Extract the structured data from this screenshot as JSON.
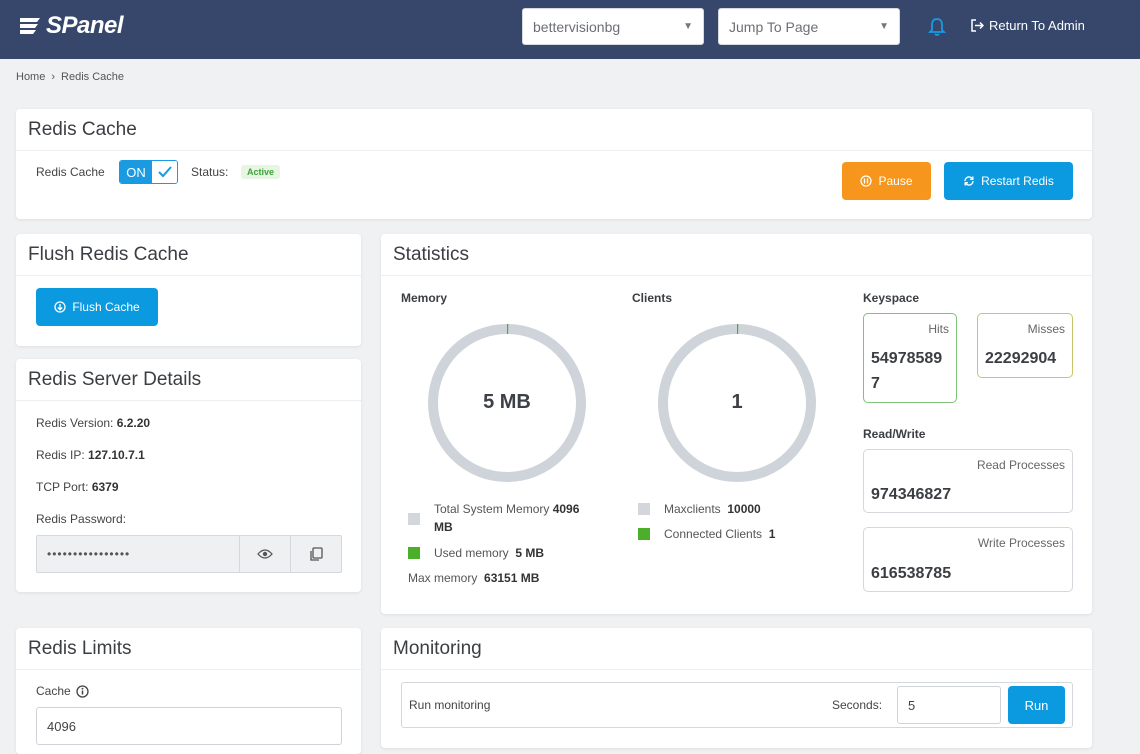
{
  "header": {
    "logo_text": "SPanel",
    "account_select": "bettervisionbg",
    "jump_select": "Jump To Page",
    "return_label": "Return To Admin"
  },
  "breadcrumb": {
    "home": "Home",
    "current": "Redis Cache"
  },
  "redis_cache": {
    "title": "Redis Cache",
    "toggle_label": "Redis Cache",
    "toggle_state": "ON",
    "status_label": "Status:",
    "status_value": "Active",
    "pause_label": "Pause",
    "restart_label": "Restart Redis"
  },
  "flush": {
    "title": "Flush Redis Cache",
    "button_label": "Flush Cache"
  },
  "server": {
    "title": "Redis Server Details",
    "version_label": "Redis Version:",
    "version_value": "6.2.20",
    "ip_label": "Redis IP:",
    "ip_value": "127.10.7.1",
    "port_label": "TCP Port:",
    "port_value": "6379",
    "password_label": "Redis Password:",
    "password_value": "••••••••••••••••"
  },
  "statistics": {
    "title": "Statistics",
    "memory": {
      "heading": "Memory",
      "ring_value": "5 MB",
      "used_fraction": 0.0012,
      "total_label": "Total System Memory",
      "total_value_1": "4096",
      "total_value_2": "MB",
      "used_label": "Used memory",
      "used_value": "5 MB",
      "max_label": "Max memory",
      "max_value": "63151 MB"
    },
    "clients": {
      "heading": "Clients",
      "ring_value": "1",
      "connected_fraction": 0.0001,
      "maxclients_label": "Maxclients",
      "maxclients_value": "10000",
      "connected_label": "Connected Clients",
      "connected_value": "1"
    },
    "keyspace": {
      "heading": "Keyspace",
      "hits_label": "Hits",
      "hits_line1": "54978589",
      "hits_line2": "7",
      "misses_label": "Misses",
      "misses_value": "22292904"
    },
    "readwrite": {
      "heading": "Read/Write",
      "read_label": "Read Processes",
      "read_value": "974346827",
      "write_label": "Write Processes",
      "write_value": "616538785"
    }
  },
  "limits": {
    "title": "Redis Limits",
    "cache_label": "Cache",
    "cache_value": "4096"
  },
  "monitoring": {
    "title": "Monitoring",
    "run_label": "Run monitoring",
    "seconds_label": "Seconds:",
    "seconds_value": "5",
    "run_button": "Run"
  },
  "colors": {
    "topbar": "#36476b",
    "accent_blue": "#0b99e0",
    "orange": "#f7961d",
    "green": "#4caf2a",
    "ring_grey": "#cfd4da",
    "hits_border": "#7fc27a",
    "misses_border": "#c8c46a"
  }
}
